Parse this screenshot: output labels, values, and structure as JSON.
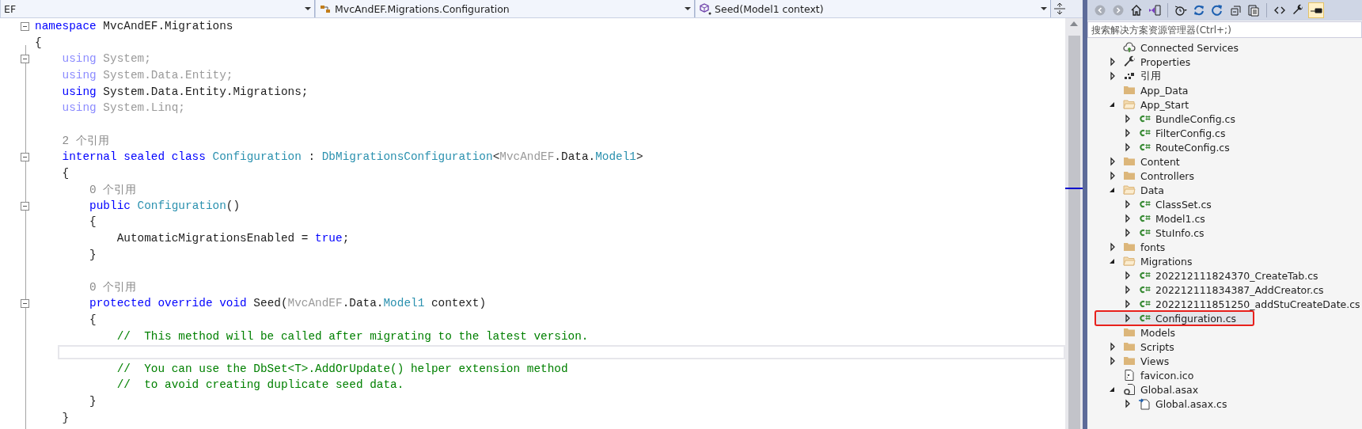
{
  "navigation_bar": [
    {
      "kind": "plain",
      "text": "EF"
    },
    {
      "kind": "class",
      "text": "MvcAndEF.Migrations.Configuration"
    },
    {
      "kind": "method",
      "text": "Seed(Model1 context)"
    }
  ],
  "code_lines": [
    {
      "kind": "code",
      "collapsible": true,
      "current": false,
      "tokens": [
        {
          "kind": "keyword",
          "text": "namespace"
        },
        {
          "kind": "plain",
          "text": " MvcAndEF.Migrations"
        }
      ]
    },
    {
      "kind": "code",
      "current": false,
      "tokens": [
        {
          "kind": "plain",
          "text": "{"
        }
      ]
    },
    {
      "kind": "code",
      "collapsible": true,
      "current": false,
      "tokens": [
        {
          "kind": "faded-keyword",
          "text": "    using"
        },
        {
          "kind": "faded",
          "text": " System;"
        }
      ]
    },
    {
      "kind": "code",
      "current": false,
      "tokens": [
        {
          "kind": "faded-keyword",
          "text": "    using"
        },
        {
          "kind": "faded",
          "text": " System.Data.Entity;"
        }
      ]
    },
    {
      "kind": "code",
      "current": false,
      "tokens": [
        {
          "kind": "keyword",
          "text": "    using"
        },
        {
          "kind": "plain",
          "text": " System.Data.Entity.Migrations;"
        }
      ]
    },
    {
      "kind": "code",
      "current": false,
      "tokens": [
        {
          "kind": "faded-keyword",
          "text": "    using"
        },
        {
          "kind": "faded",
          "text": " System.Linq;"
        }
      ]
    },
    {
      "kind": "blank"
    },
    {
      "kind": "code",
      "current": false,
      "tokens": [
        {
          "kind": "lens",
          "text": "    2 个引用"
        }
      ]
    },
    {
      "kind": "code",
      "collapsible": true,
      "current": false,
      "tokens": [
        {
          "kind": "keyword",
          "text": "    internal sealed class "
        },
        {
          "kind": "type",
          "text": "Configuration"
        },
        {
          "kind": "plain",
          "text": " : "
        },
        {
          "kind": "type",
          "text": "DbMigrationsConfiguration"
        },
        {
          "kind": "plain",
          "text": "<"
        },
        {
          "kind": "faded",
          "text": "MvcAndEF"
        },
        {
          "kind": "plain",
          "text": ".Data."
        },
        {
          "kind": "type",
          "text": "Model1"
        },
        {
          "kind": "plain",
          "text": ">"
        }
      ]
    },
    {
      "kind": "code",
      "current": false,
      "tokens": [
        {
          "kind": "plain",
          "text": "    {"
        }
      ]
    },
    {
      "kind": "code",
      "current": false,
      "tokens": [
        {
          "kind": "lens",
          "text": "        0 个引用"
        }
      ]
    },
    {
      "kind": "code",
      "collapsible": true,
      "current": false,
      "tokens": [
        {
          "kind": "keyword",
          "text": "        public "
        },
        {
          "kind": "type",
          "text": "Configuration"
        },
        {
          "kind": "plain",
          "text": "()"
        }
      ]
    },
    {
      "kind": "code",
      "current": false,
      "tokens": [
        {
          "kind": "plain",
          "text": "        {"
        }
      ]
    },
    {
      "kind": "code",
      "current": false,
      "tokens": [
        {
          "kind": "plain",
          "text": "            AutomaticMigrationsEnabled = "
        },
        {
          "kind": "keyword",
          "text": "true"
        },
        {
          "kind": "plain",
          "text": ";"
        }
      ]
    },
    {
      "kind": "code",
      "current": false,
      "tokens": [
        {
          "kind": "plain",
          "text": "        }"
        }
      ]
    },
    {
      "kind": "blank"
    },
    {
      "kind": "code",
      "current": false,
      "tokens": [
        {
          "kind": "lens",
          "text": "        0 个引用"
        }
      ]
    },
    {
      "kind": "code",
      "collapsible": true,
      "current": false,
      "tokens": [
        {
          "kind": "keyword",
          "text": "        protected override void"
        },
        {
          "kind": "plain",
          "text": " Seed("
        },
        {
          "kind": "faded",
          "text": "MvcAndEF"
        },
        {
          "kind": "plain",
          "text": ".Data."
        },
        {
          "kind": "type",
          "text": "Model1"
        },
        {
          "kind": "plain",
          "text": " context)"
        }
      ]
    },
    {
      "kind": "code",
      "current": false,
      "tokens": [
        {
          "kind": "plain",
          "text": "        {"
        }
      ]
    },
    {
      "kind": "code",
      "current": false,
      "tokens": [
        {
          "kind": "comment",
          "text": "            //  This method will be called after migrating to the latest version."
        }
      ]
    },
    {
      "kind": "blank",
      "current": true
    },
    {
      "kind": "code",
      "current": false,
      "tokens": [
        {
          "kind": "comment",
          "text": "            //  You can use the DbSet<T>.AddOrUpdate() helper extension method"
        }
      ]
    },
    {
      "kind": "code",
      "current": false,
      "tokens": [
        {
          "kind": "comment",
          "text": "            //  to avoid creating duplicate seed data."
        }
      ]
    },
    {
      "kind": "code",
      "current": false,
      "tokens": [
        {
          "kind": "plain",
          "text": "        }"
        }
      ]
    },
    {
      "kind": "code",
      "current": false,
      "tokens": [
        {
          "kind": "plain",
          "text": "    }"
        }
      ]
    }
  ],
  "solution_explorer": {
    "toolbar": [
      {
        "kind": "back",
        "disabled": true
      },
      {
        "kind": "forward",
        "disabled": true
      },
      {
        "kind": "home",
        "disabled": false
      },
      {
        "kind": "solution",
        "disabled": false
      },
      {
        "kind": "history",
        "disabled": false
      },
      {
        "kind": "sync",
        "disabled": false
      },
      {
        "kind": "refresh",
        "disabled": false
      },
      {
        "kind": "collapse",
        "disabled": false
      },
      {
        "kind": "show-all",
        "disabled": false
      },
      {
        "kind": "code",
        "disabled": false
      },
      {
        "kind": "properties",
        "disabled": false
      },
      {
        "kind": "preview",
        "disabled": false,
        "pressed": true
      }
    ],
    "search": {
      "placeholder": "搜索解决方案资源管理器(Ctrl+;)"
    },
    "tree": [
      {
        "kind": "service",
        "label": "Connected Services",
        "selected": false
      },
      {
        "kind": "wrench",
        "label": "Properties",
        "expanded": false,
        "selected": false
      },
      {
        "kind": "references",
        "label": "引用",
        "expanded": false,
        "selected": false
      },
      {
        "kind": "folder",
        "label": "App_Data",
        "selected": false
      },
      {
        "kind": "folder",
        "label": "App_Start",
        "expanded": true,
        "selected": false,
        "children": [
          {
            "kind": "cs",
            "label": "BundleConfig.cs",
            "expanded": false,
            "selected": false
          },
          {
            "kind": "cs",
            "label": "FilterConfig.cs",
            "expanded": false,
            "selected": false
          },
          {
            "kind": "cs",
            "label": "RouteConfig.cs",
            "expanded": false,
            "selected": false
          }
        ]
      },
      {
        "kind": "folder",
        "label": "Content",
        "expanded": false,
        "selected": false
      },
      {
        "kind": "folder",
        "label": "Controllers",
        "expanded": false,
        "selected": false
      },
      {
        "kind": "folder",
        "label": "Data",
        "expanded": true,
        "selected": false,
        "children": [
          {
            "kind": "cs",
            "label": "ClassSet.cs",
            "expanded": false,
            "selected": false
          },
          {
            "kind": "cs",
            "label": "Model1.cs",
            "expanded": false,
            "selected": false
          },
          {
            "kind": "cs",
            "label": "StuInfo.cs",
            "expanded": false,
            "selected": false
          }
        ]
      },
      {
        "kind": "folder",
        "label": "fonts",
        "expanded": false,
        "selected": false
      },
      {
        "kind": "folder",
        "label": "Migrations",
        "expanded": true,
        "selected": false,
        "children": [
          {
            "kind": "cs",
            "label": "202212111824370_CreateTab.cs",
            "expanded": false,
            "selected": false
          },
          {
            "kind": "cs",
            "label": "202212111834387_AddCreator.cs",
            "expanded": false,
            "selected": false
          },
          {
            "kind": "cs",
            "label": "202212111851250_addStuCreateDate.cs",
            "expanded": false,
            "selected": false
          },
          {
            "kind": "cs",
            "label": "Configuration.cs",
            "expanded": false,
            "selected": true,
            "annotated": true
          }
        ]
      },
      {
        "kind": "folder",
        "label": "Models",
        "selected": false
      },
      {
        "kind": "folder",
        "label": "Scripts",
        "expanded": false,
        "selected": false
      },
      {
        "kind": "folder",
        "label": "Views",
        "expanded": false,
        "selected": false
      },
      {
        "kind": "file",
        "label": "favicon.ico",
        "selected": false
      },
      {
        "kind": "asax",
        "label": "Global.asax",
        "expanded": true,
        "selected": false,
        "children": [
          {
            "kind": "cs-link",
            "label": "Global.asax.cs",
            "expanded": false,
            "selected": false
          }
        ]
      }
    ]
  }
}
